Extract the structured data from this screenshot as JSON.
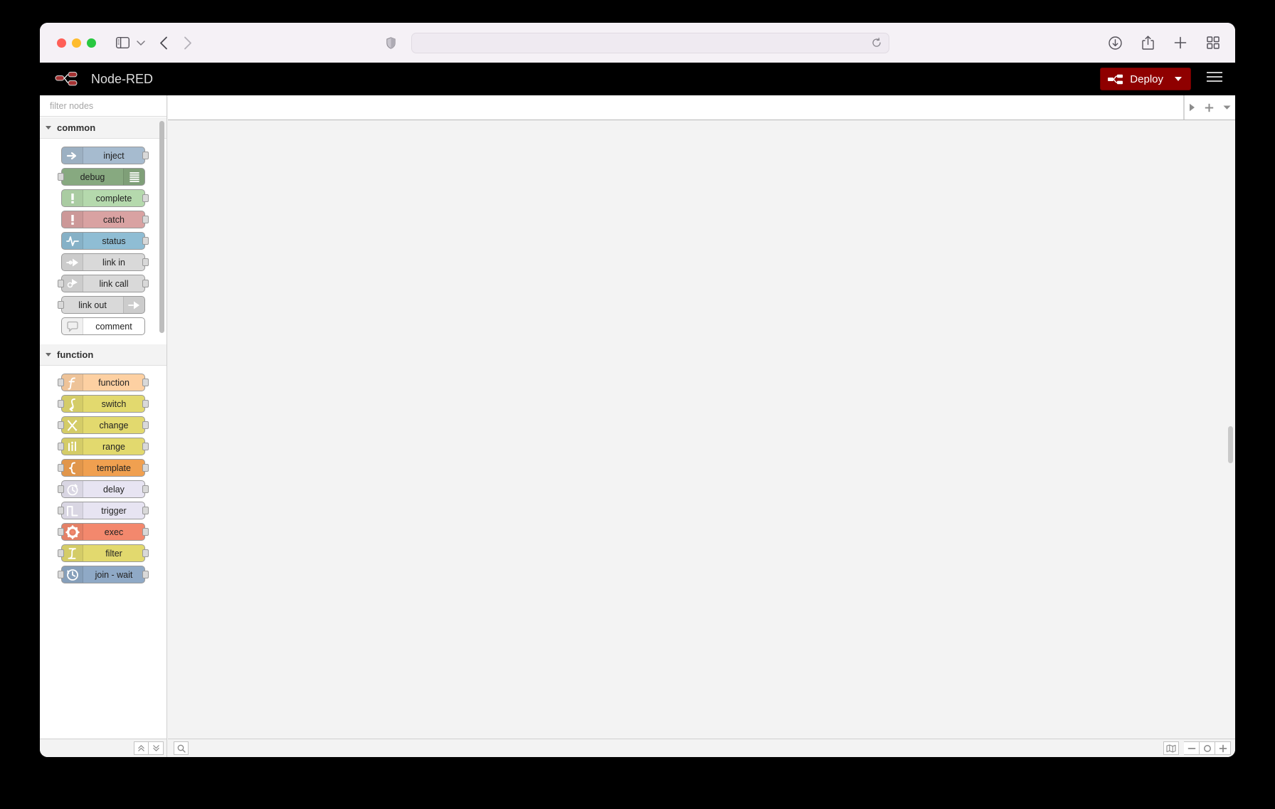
{
  "browser": {
    "traffic_lights": [
      "close",
      "minimize",
      "maximize"
    ],
    "sidebar_toggle_label": "Show sidebar",
    "tab_overview_label": "Tab overview",
    "url_value": "",
    "url_placeholder": "",
    "back_label": "Back",
    "forward_label": "Forward",
    "reload_label": "Reload",
    "shield_label": "Privacy report",
    "download_label": "Downloads",
    "share_label": "Share",
    "newtab_label": "New tab"
  },
  "header": {
    "title": "Node-RED",
    "deploy_label": "Deploy",
    "deploy_color": "#8f0000",
    "menu_label": "Main menu"
  },
  "palette": {
    "search_placeholder": "filter nodes",
    "search_value": "",
    "categories": [
      {
        "name": "common",
        "expanded": true,
        "nodes": [
          {
            "label": "inject",
            "color": "#a6bbcf",
            "icon": "arrow-right-icon",
            "icon_side": "left",
            "has_input": false,
            "has_output": true
          },
          {
            "label": "debug",
            "color": "#87a980",
            "icon": "debug-lines-icon",
            "icon_side": "right",
            "has_input": true,
            "has_output": false
          },
          {
            "label": "complete",
            "color": "#b5d9ad",
            "icon": "exclamation-icon",
            "icon_side": "left",
            "has_input": false,
            "has_output": true
          },
          {
            "label": "catch",
            "color": "#d9a2a2",
            "icon": "exclamation-icon",
            "icon_side": "left",
            "has_input": false,
            "has_output": true
          },
          {
            "label": "status",
            "color": "#8fbdd4",
            "icon": "pulse-icon",
            "icon_side": "left",
            "has_input": false,
            "has_output": true
          },
          {
            "label": "link in",
            "color": "#d9d9d9",
            "icon": "link-in-icon",
            "icon_side": "left",
            "has_input": false,
            "has_output": true
          },
          {
            "label": "link call",
            "color": "#d9d9d9",
            "icon": "link-call-icon",
            "icon_side": "left",
            "has_input": true,
            "has_output": true
          },
          {
            "label": "link out",
            "color": "#d9d9d9",
            "icon": "link-out-icon",
            "icon_side": "right",
            "has_input": true,
            "has_output": false
          },
          {
            "label": "comment",
            "color": "#ffffff",
            "icon": "comment-icon",
            "icon_side": "left",
            "has_input": false,
            "has_output": false
          }
        ]
      },
      {
        "name": "function",
        "expanded": true,
        "nodes": [
          {
            "label": "function",
            "color": "#fdd0a2",
            "icon": "function-f-icon",
            "icon_side": "left",
            "has_input": true,
            "has_output": true
          },
          {
            "label": "switch",
            "color": "#e2d96e",
            "icon": "switch-icon",
            "icon_side": "left",
            "has_input": true,
            "has_output": true
          },
          {
            "label": "change",
            "color": "#e2d96e",
            "icon": "change-icon",
            "icon_side": "left",
            "has_input": true,
            "has_output": true
          },
          {
            "label": "range",
            "color": "#e2d96e",
            "icon": "range-icon",
            "icon_side": "left",
            "has_input": true,
            "has_output": true
          },
          {
            "label": "template",
            "color": "#f0a050",
            "icon": "brace-icon",
            "icon_side": "left",
            "has_input": true,
            "has_output": true
          },
          {
            "label": "delay",
            "color": "#e7e4f2",
            "icon": "stopwatch-icon",
            "icon_side": "left",
            "has_input": true,
            "has_output": true
          },
          {
            "label": "trigger",
            "color": "#e7e4f2",
            "icon": "pulse-step-icon",
            "icon_side": "left",
            "has_input": true,
            "has_output": true
          },
          {
            "label": "exec",
            "color": "#f3886d",
            "icon": "gear-icon",
            "icon_side": "left",
            "has_input": true,
            "has_output": true
          },
          {
            "label": "filter",
            "color": "#e2d96e",
            "icon": "filter-icon",
            "icon_side": "left",
            "has_input": true,
            "has_output": true
          },
          {
            "label": "join - wait",
            "color": "#8fa9c6",
            "icon": "clock-icon",
            "icon_side": "left",
            "has_input": true,
            "has_output": true
          }
        ]
      }
    ],
    "footer": {
      "collapse_all_label": "Collapse all",
      "expand_all_label": "Expand all"
    }
  },
  "workspace": {
    "tabs": [],
    "tools": {
      "toggle_label": "Show/hide tabs",
      "add_tab_label": "Add flow",
      "tab_menu_label": "Flow options"
    }
  },
  "status_bar": {
    "search_label": "Search flows",
    "navigator_label": "Navigator",
    "zoom_out_label": "Zoom out",
    "zoom_reset_label": "Zoom reset",
    "zoom_in_label": "Zoom in"
  }
}
